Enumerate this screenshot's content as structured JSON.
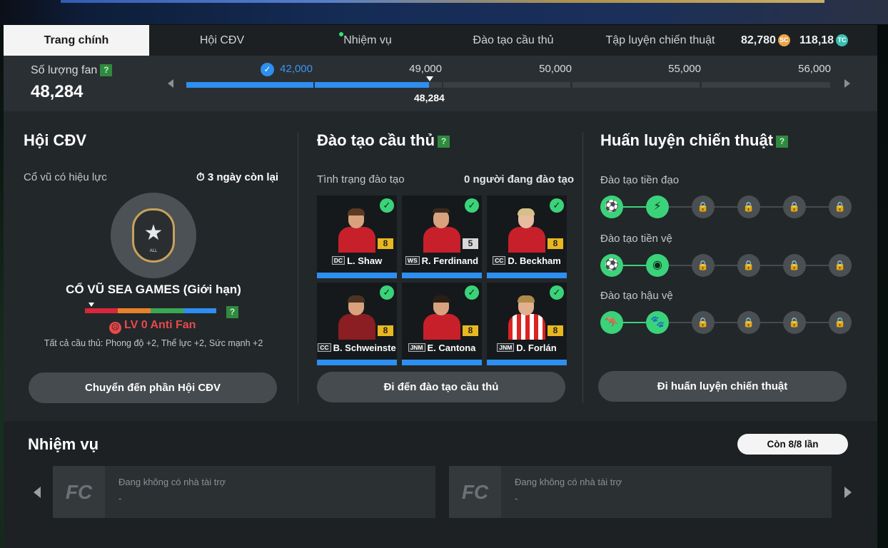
{
  "tabs": [
    {
      "label": "Trang chính",
      "active": true
    },
    {
      "label": "Hội CĐV",
      "active": false
    },
    {
      "label": "Nhiệm vụ",
      "active": false,
      "has_dot": true
    },
    {
      "label": "Đào tạo cầu thủ",
      "active": false
    },
    {
      "label": "Tập luyện chiến thuật",
      "active": false
    }
  ],
  "currency": {
    "sc": "82,780",
    "sc_icon": "SC",
    "tc": "118,18",
    "tc_icon": "TC"
  },
  "fan": {
    "label": "Số lượng fan",
    "help": "?",
    "value": "48,284",
    "milestones": [
      "42,000",
      "49,000",
      "50,000",
      "55,000",
      "56,000"
    ],
    "current_marker": "48,284",
    "progress_fraction_between_42000_and_49000": 0.9
  },
  "supporters": {
    "title": "Hội CĐV",
    "active_cheer_label": "Cổ vũ có hiệu lực",
    "timer": "3 ngày còn lại",
    "cheer_title": "CỔ VŨ SEA GAMES (Giới hạn)",
    "badge_text": "ALL",
    "help": "?",
    "level": "LV 0 Anti Fan",
    "bonus": "Tất cả cầu thủ: Phong độ +2, Thể lực +2, Sức mạnh +2",
    "button": "Chuyển đến phần Hội CĐV",
    "bar_colors": [
      "#d8263b",
      "#e8822a",
      "#3aa852",
      "#2d8ff0"
    ]
  },
  "training": {
    "title": "Đào tạo cầu thủ",
    "help": "?",
    "status_label": "Tình trạng đào tạo",
    "status_value": "0 người đang đào tạo",
    "players": [
      {
        "pos": "DC",
        "name": "L. Shaw",
        "rating": "8"
      },
      {
        "pos": "WS",
        "name": "R. Ferdinand",
        "rating": "5"
      },
      {
        "pos": "CC",
        "name": "D. Beckham",
        "rating": "8"
      },
      {
        "pos": "CC",
        "name": "B. Schweinste",
        "rating": "8"
      },
      {
        "pos": "JNM",
        "name": "E. Cantona",
        "rating": "8"
      },
      {
        "pos": "JNM",
        "name": "D. Forlán",
        "rating": "8"
      }
    ],
    "button": "Đi đến đào tạo cầu thủ"
  },
  "tactics": {
    "title": "Huấn luyện chiến thuật",
    "help": "?",
    "tracks": [
      {
        "label": "Đào tạo tiền đạo",
        "icons": [
          "ball-kick-icon",
          "lightning-icon"
        ]
      },
      {
        "label": "Đào tạo tiền vệ",
        "icons": [
          "ball-icon",
          "eye-icon"
        ]
      },
      {
        "label": "Đào tạo hậu vệ",
        "icons": [
          "kangaroo-icon",
          "paw-icon"
        ]
      }
    ],
    "button": "Đi huấn luyện chiến thuật"
  },
  "missions": {
    "title": "Nhiệm vụ",
    "remaining": "Còn 8/8 lần",
    "sponsors": [
      {
        "text": "Đang không có nhà tài trợ",
        "sub": "-"
      },
      {
        "text": "Đang không có nhà tài trợ",
        "sub": "-"
      }
    ]
  }
}
